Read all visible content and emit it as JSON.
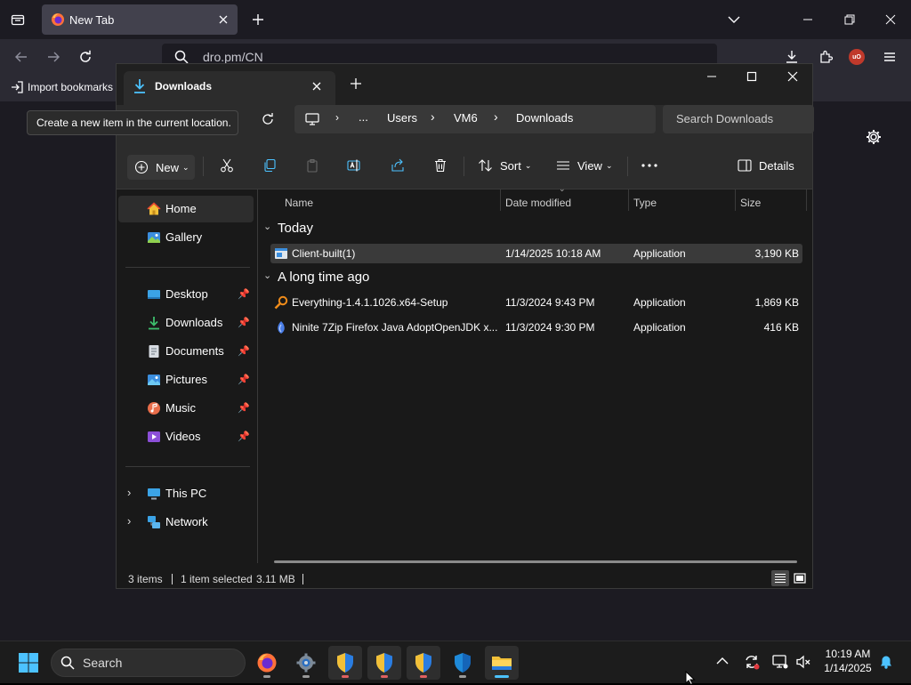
{
  "browser": {
    "tab_title": "New Tab",
    "url": "dro.pm/CN",
    "import_bookmarks": "Import bookmarks",
    "ublock_badge": "uO",
    "icons": [
      "list-all-tabs-icon",
      "firefox-logo-icon",
      "close-tab-icon",
      "new-tab-icon",
      "tab-list-chevron-icon",
      "minimize-icon",
      "restore-icon",
      "close-icon",
      "back-icon",
      "forward-icon",
      "reload-icon",
      "search-icon",
      "downloads-icon",
      "extensions-icon",
      "ublock-icon",
      "menu-icon",
      "settings-gear-icon"
    ]
  },
  "tooltip": "Create a new item in the current location.",
  "explorer": {
    "tab_title": "Downloads",
    "breadcrumb": [
      "...",
      "Users",
      "VM6",
      "Downloads"
    ],
    "search_placeholder": "Search Downloads",
    "commands": {
      "new_label": "New",
      "sort_label": "Sort",
      "view_label": "View",
      "details_label": "Details"
    },
    "sidebar": {
      "top": [
        {
          "label": "Home",
          "icon": "home-icon",
          "selected": true
        },
        {
          "label": "Gallery",
          "icon": "gallery-icon"
        }
      ],
      "pinned": [
        {
          "label": "Desktop",
          "icon": "desktop-icon"
        },
        {
          "label": "Downloads",
          "icon": "downloads-icon"
        },
        {
          "label": "Documents",
          "icon": "documents-icon"
        },
        {
          "label": "Pictures",
          "icon": "pictures-icon"
        },
        {
          "label": "Music",
          "icon": "music-icon"
        },
        {
          "label": "Videos",
          "icon": "videos-icon"
        }
      ],
      "devices": [
        {
          "label": "This PC",
          "icon": "this-pc-icon"
        },
        {
          "label": "Network",
          "icon": "network-icon"
        }
      ]
    },
    "columns": [
      "Name",
      "Date modified",
      "Type",
      "Size"
    ],
    "groups": [
      {
        "title": "Today",
        "files": [
          {
            "name": "Client-built(1)",
            "date": "1/14/2025 10:18 AM",
            "type": "Application",
            "size": "3,190 KB",
            "selected": true,
            "icon": "application-icon"
          }
        ]
      },
      {
        "title": "A long time ago",
        "files": [
          {
            "name": "Everything-1.4.1.1026.x64-Setup",
            "date": "11/3/2024 9:43 PM",
            "type": "Application",
            "size": "1,869 KB",
            "icon": "everything-search-icon"
          },
          {
            "name": "Ninite 7Zip Firefox Java AdoptOpenJDK x...",
            "date": "11/3/2024 9:30 PM",
            "type": "Application",
            "size": "416 KB",
            "icon": "ninite-icon"
          }
        ]
      }
    ],
    "status": {
      "items": "3 items",
      "selection": "1 item selected",
      "size": "3.11 MB"
    }
  },
  "taskbar": {
    "search_label": "Search",
    "time": "10:19 AM",
    "date": "1/14/2025",
    "apps": [
      "firefox-icon",
      "settings-icon",
      "defender-shield-icon",
      "defender-shield-icon",
      "defender-shield-icon",
      "windows-security-icon",
      "file-explorer-icon"
    ]
  },
  "colors": {
    "accent": "#4cc2ff",
    "selection": "#3a3a3a",
    "folder_yellow": "#f2c038",
    "ublock_red": "#c0392b"
  }
}
